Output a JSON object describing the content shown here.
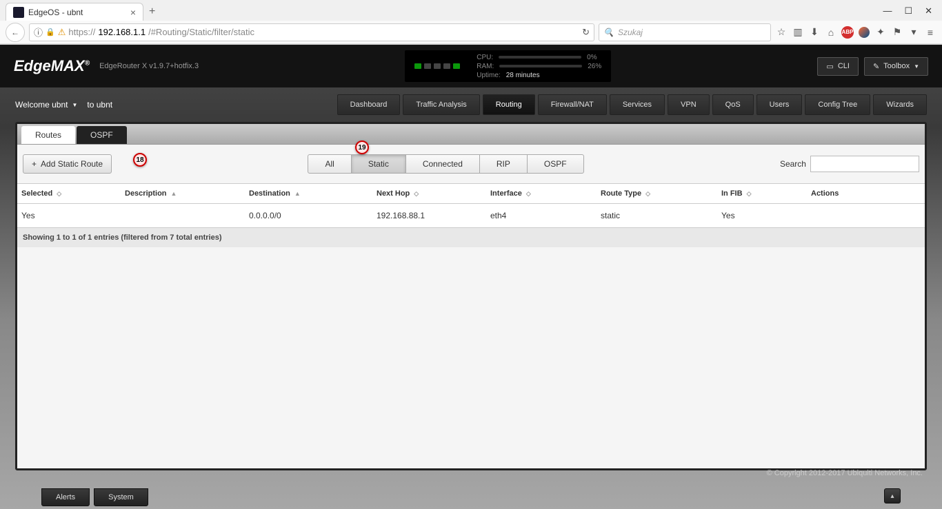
{
  "browser": {
    "tab_title": "EdgeOS - ubnt",
    "url_proto": "https://",
    "url_host": "192.168.1.1",
    "url_path": "/#Routing/Static/filter/static",
    "search_placeholder": "Szukaj"
  },
  "header": {
    "logo_edge": "Edge",
    "logo_max": "MAX",
    "model": "EdgeRouter X v1.9.7+hotfix.3",
    "cpu_label": "CPU:",
    "cpu_value": "0%",
    "cpu_pct": 2,
    "ram_label": "RAM:",
    "ram_value": "26%",
    "ram_pct": 26,
    "uptime_label": "Uptime:",
    "uptime_value": "28 minutes",
    "cli_label": "CLI",
    "toolbox_label": "Toolbox"
  },
  "subbar": {
    "welcome_text": "Welcome ubnt",
    "to_text": "to ubnt",
    "tabs": [
      "Dashboard",
      "Traffic Analysis",
      "Routing",
      "Firewall/NAT",
      "Services",
      "VPN",
      "QoS",
      "Users",
      "Config Tree",
      "Wizards"
    ],
    "active_tab": "Routing"
  },
  "inner_tabs": {
    "routes": "Routes",
    "ospf": "OSPF"
  },
  "toolbar": {
    "add_label": "Add Static Route",
    "filters": [
      "All",
      "Static",
      "Connected",
      "RIP",
      "OSPF"
    ],
    "active_filter": "Static",
    "search_label": "Search"
  },
  "table": {
    "headers": {
      "selected": "Selected",
      "description": "Description",
      "destination": "Destination",
      "next_hop": "Next Hop",
      "interface": "Interface",
      "route_type": "Route Type",
      "in_fib": "In FIB",
      "actions": "Actions"
    },
    "rows": [
      {
        "selected": "Yes",
        "description": "",
        "destination": "0.0.0.0/0",
        "next_hop": "192.168.88.1",
        "interface": "eth4",
        "route_type": "static",
        "in_fib": "Yes",
        "actions": ""
      }
    ],
    "info": "Showing 1 to 1 of 1 entries (filtered from 7 total entries)"
  },
  "footer": {
    "copyright": "© Copyright 2012-2017 Ubiquiti Networks, Inc."
  },
  "bottom": {
    "alerts": "Alerts",
    "system": "System"
  },
  "callouts": {
    "c18": "18",
    "c19": "19"
  }
}
